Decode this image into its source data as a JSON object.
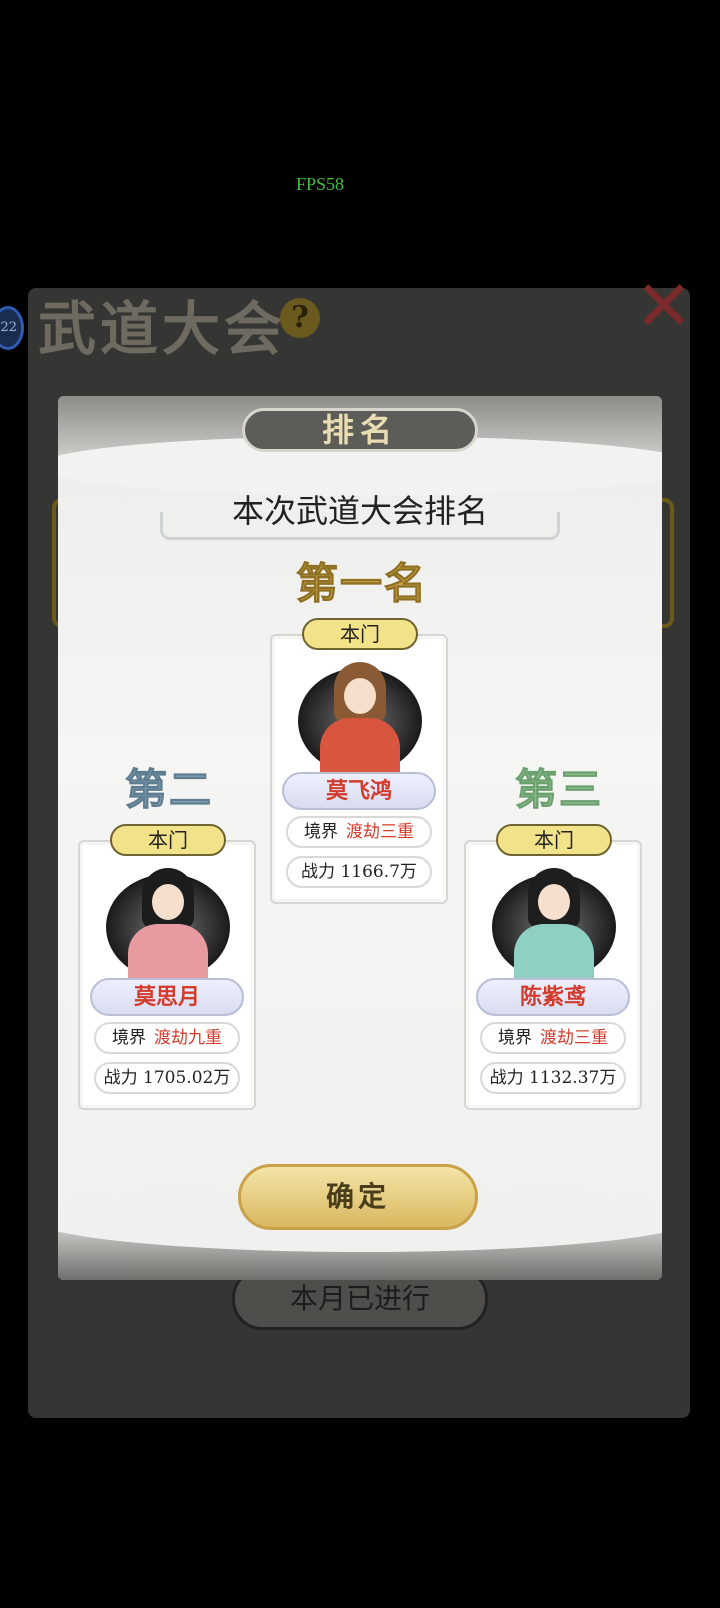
{
  "overlay": {
    "fps": "FPS58"
  },
  "background": {
    "title": "武道大会",
    "help_glyph": "?",
    "badge": "22",
    "close_glyph": "✕",
    "bottom_button": "本月已进行"
  },
  "modal": {
    "tab": "排名",
    "subtitle": "本次武道大会排名",
    "confirm": "确定",
    "ranks": [
      {
        "label": "第一名",
        "sect": "本门",
        "name": "莫飞鸿",
        "realm_label": "境界",
        "realm": "渡劫三重",
        "power_label": "战力",
        "power": "1166.7万"
      },
      {
        "label": "第二名",
        "sect": "本门",
        "name": "莫思月",
        "realm_label": "境界",
        "realm": "渡劫九重",
        "power_label": "战力",
        "power": "1705.02万"
      },
      {
        "label": "第三名",
        "sect": "本门",
        "name": "陈紫鸢",
        "realm_label": "境界",
        "realm": "渡劫三重",
        "power_label": "战力",
        "power": "1132.37万"
      }
    ]
  },
  "colors": {
    "gold": "#c9a64a",
    "silver": "#8aa6b8",
    "jade": "#9ccf9e",
    "name_red": "#d33c2c"
  }
}
